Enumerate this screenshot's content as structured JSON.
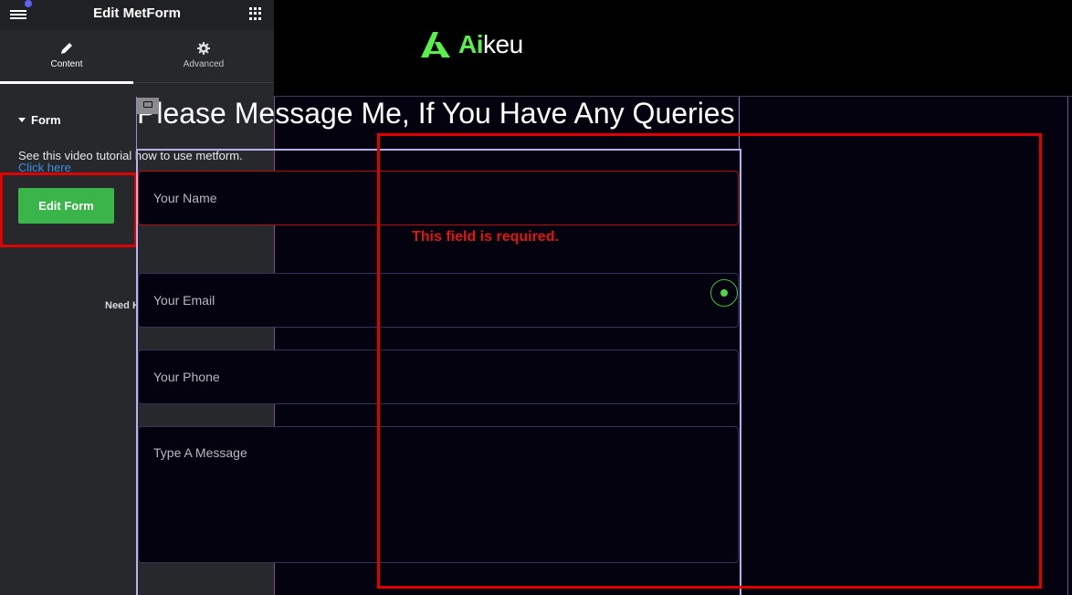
{
  "panel": {
    "title": "Edit MetForm",
    "tabs": [
      {
        "label": "Content",
        "icon": "pencil-icon",
        "active": true
      },
      {
        "label": "Advanced",
        "icon": "gear-icon",
        "active": false
      }
    ],
    "section_title": "Form",
    "tutorial_text": "See this video tutorial how to use metform.",
    "tutorial_link": "Click here",
    "edit_form_button": "Edit Form",
    "need_help": "Need Help"
  },
  "site": {
    "logo_ai": "Ai",
    "logo_rest": "keu",
    "brand_color": "#5af04a"
  },
  "form": {
    "heading": "Please Message Me, If You Have Any Queries",
    "fields": {
      "name_placeholder": "Your Name",
      "email_placeholder": "Your Email",
      "phone_placeholder": "Your Phone",
      "message_placeholder": "Type A Message"
    },
    "error_text": "This field is required.",
    "error_color": "#e01616"
  }
}
